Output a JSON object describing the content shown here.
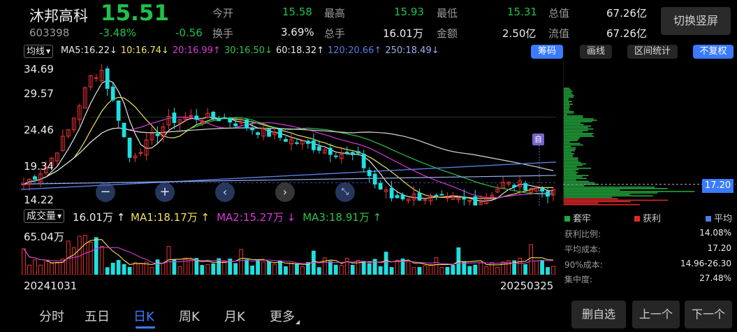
{
  "stock": {
    "name": "沐邦高科",
    "code": "603398",
    "price": "15.51",
    "change_pct": "-3.48%",
    "change": "-0.56"
  },
  "quote": [
    {
      "label": "今开",
      "value": "15.58"
    },
    {
      "label": "最高",
      "value": "15.93"
    },
    {
      "label": "最低",
      "value": "15.31"
    },
    {
      "label": "总值",
      "value": "67.26亿"
    },
    {
      "label": "换手",
      "value": "3.69%"
    },
    {
      "label": "总手",
      "value": "16.01万"
    },
    {
      "label": "金额",
      "value": "2.50亿"
    },
    {
      "label": "流值",
      "value": "67.26亿"
    }
  ],
  "switch_button": "切换竖屏",
  "ma_bar": {
    "selector": "均线",
    "items": [
      {
        "text": "MA5:16.22",
        "arrow": "↓",
        "color": "#e8e8e8"
      },
      {
        "text": "10:16.74",
        "arrow": "↓",
        "color": "#f2e35c"
      },
      {
        "text": "20:16.99",
        "arrow": "↑",
        "color": "#d83ad8"
      },
      {
        "text": "30:16.50",
        "arrow": "↓",
        "color": "#2ec24a"
      },
      {
        "text": "60:18.32",
        "arrow": "↑",
        "color": "#e8e8e8"
      },
      {
        "text": "120:20.66",
        "arrow": "↑",
        "color": "#5a7de6"
      },
      {
        "text": "250:18.49",
        "arrow": "↓",
        "color": "#9ab0ee"
      }
    ],
    "buttons": [
      "筹码",
      "画线",
      "区间统计",
      "不复权"
    ]
  },
  "price_axis": [
    "34.69",
    "29.57",
    "24.46",
    "19.34",
    "14.22"
  ],
  "marker": "自",
  "chip_price": "17.20",
  "vol_bar": {
    "selector": "成交量",
    "value": "16.01万",
    "value_arrow": "↑",
    "ma": [
      {
        "text": "MA1:18.17万",
        "arrow": "↑",
        "color": "#f2e35c"
      },
      {
        "text": "MA2:15.27万",
        "arrow": "↓",
        "color": "#d83ad8"
      },
      {
        "text": "MA3:18.91万",
        "arrow": "↑",
        "color": "#2ec24a"
      }
    ],
    "max_label": "65.04万"
  },
  "date_start": "20241031",
  "date_end": "20250325",
  "chip_legend": [
    {
      "label": "套牢",
      "color": "#22a83c"
    },
    {
      "label": "获利",
      "color": "#e0282a"
    },
    {
      "label": "平均",
      "color": "#4c7de6"
    }
  ],
  "chip_stats": [
    {
      "label": "获利比例:",
      "value": "14.08%"
    },
    {
      "label": "平均成本:",
      "value": "17.20"
    },
    {
      "label": "90%成本:",
      "value": "14.96-26.30"
    },
    {
      "label": "集中度:",
      "value": "27.48%"
    }
  ],
  "tabs": [
    {
      "label": "分时",
      "active": false
    },
    {
      "label": "五日",
      "active": false
    },
    {
      "label": "日K",
      "active": true
    },
    {
      "label": "周K",
      "active": false
    },
    {
      "label": "月K",
      "active": false
    },
    {
      "label": "更多",
      "active": false
    }
  ],
  "bottom_buttons": [
    "删自选",
    "上一个",
    "下一个"
  ],
  "colors": {
    "up": "#ee3333",
    "down": "#1fe0e0",
    "accent": "#3a7bff",
    "bg": "#000000"
  }
}
